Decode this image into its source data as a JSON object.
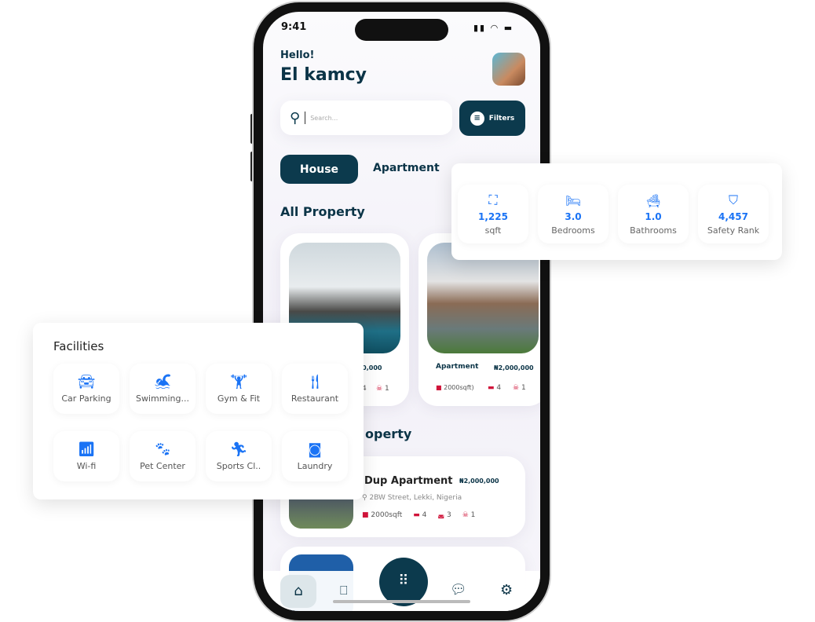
{
  "status_bar": {
    "time": "9:41"
  },
  "header": {
    "greeting": "Hello!",
    "name": "El kamcy"
  },
  "search": {
    "placeholder": "Search...",
    "filters_label": "Filters"
  },
  "tabs": [
    {
      "label": "House",
      "active": true
    },
    {
      "label": "Apartment",
      "active": false
    }
  ],
  "section_all": "All Property",
  "property_cards": [
    {
      "title": "",
      "price": ",000,000",
      "beds": "4",
      "extra": "1"
    },
    {
      "title": "Apartment",
      "price": "₦2,000,000",
      "area": "2000sqft)",
      "beds": "4",
      "extra": "1"
    }
  ],
  "section_second": "operty",
  "list_items": [
    {
      "title": "Dup Apartment",
      "price": "₦2,000,000",
      "address": "2BW Street, Lekki, Nigeria",
      "area": "2000sqft",
      "beds": "4",
      "baths": "3",
      "extra": "1"
    }
  ],
  "nav": {
    "items": [
      "home-icon",
      "bookmark-icon",
      "grid-icon",
      "chat-icon",
      "settings-icon"
    ],
    "active": "home"
  },
  "stats": [
    {
      "value": "1,225",
      "label": "sqft",
      "icon": "area-icon"
    },
    {
      "value": "3.0",
      "label": "Bedrooms",
      "icon": "bed-icon"
    },
    {
      "value": "1.0",
      "label": "Bathrooms",
      "icon": "bathtub-icon"
    },
    {
      "value": "4,457",
      "label": "Safety Rank",
      "icon": "shield-check-icon"
    }
  ],
  "facilities": {
    "title": "Facilities",
    "items": [
      {
        "label": "Car Parking",
        "icon": "car-icon"
      },
      {
        "label": "Swimming...",
        "icon": "swimming-icon"
      },
      {
        "label": "Gym & Fit",
        "icon": "dumbbell-icon"
      },
      {
        "label": "Restaurant",
        "icon": "utensils-icon"
      },
      {
        "label": "Wi-fi",
        "icon": "wifi-icon"
      },
      {
        "label": "Pet Center",
        "icon": "paw-icon"
      },
      {
        "label": "Sports Cl..",
        "icon": "running-icon"
      },
      {
        "label": "Laundry",
        "icon": "washing-machine-icon"
      }
    ]
  },
  "colors": {
    "primary": "#0c3a4d",
    "accent": "#1a73f5",
    "feature": "#d0143a"
  }
}
